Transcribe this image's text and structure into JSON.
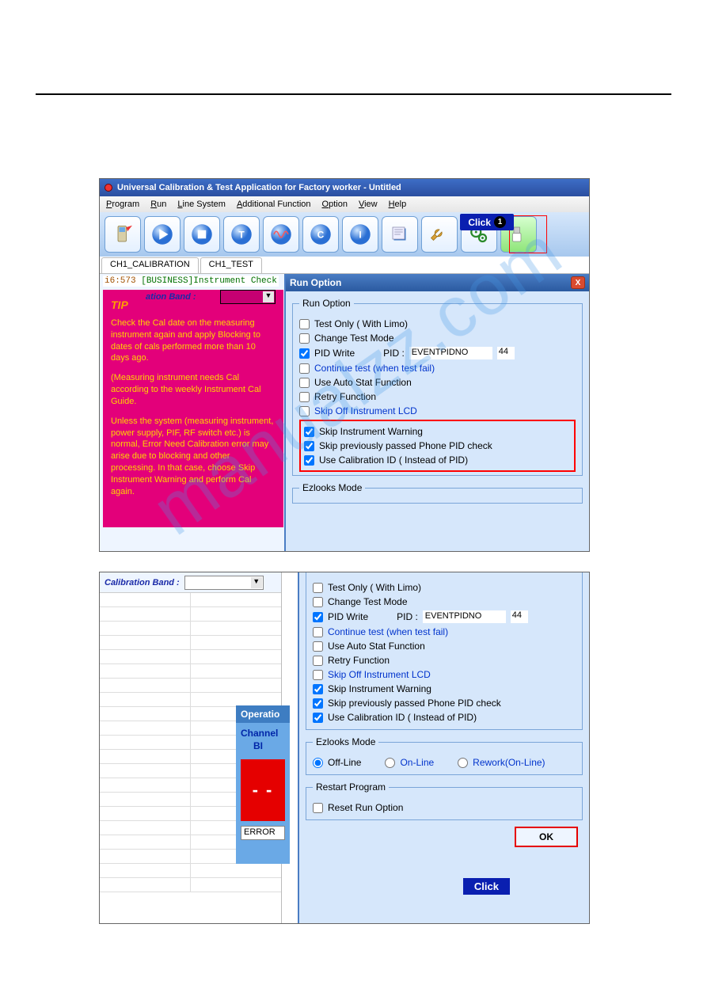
{
  "watermark": "manualzz.com",
  "app": {
    "title": "Universal Calibration & Test Application for Factory worker - Untitled",
    "menu": [
      "Program",
      "Run",
      "Line System",
      "Additional Function",
      "Option",
      "View",
      "Help"
    ],
    "tabs": [
      "CH1_CALIBRATION",
      "CH1_TEST"
    ],
    "status_line": {
      "ts": "i6:573",
      "tag": "[BUSINESS]",
      "msg": "Instrument Check"
    },
    "click_badge": "Click",
    "click_num": "1"
  },
  "tip": {
    "title": "TIP",
    "cal_band_label": "ation Band :",
    "p1": "Check the Cal date on the measuring instrument again and apply Blocking to dates of cals performed more than 10 days ago.",
    "p2": "(Measuring instrument needs Cal according to the weekly Instrument Cal Guide.",
    "p3": "Unless the system (measuring instrument, power supply, PIF, RF switch etc.) is normal, Error Need Calibration error may arise due to blocking and other processing. In that case, choose Skip Instrument Warning and perform Cal again."
  },
  "run_option": {
    "dialog_title": "Run Option",
    "group_label": "Run Option",
    "opts": {
      "test_only": "Test Only ( With Limo)",
      "change_mode": "Change Test Mode",
      "pid_write": "PID Write",
      "pid_label": "PID : ",
      "pid_value": "EVENTPIDNO",
      "pid_num": "44",
      "continue": "Continue test (when test fail)",
      "auto_stat": "Use Auto Stat Function",
      "retry": "Retry Function",
      "skip_off_lcd": "Skip Off Instrument LCD",
      "skip_warn": "Skip Instrument Warning",
      "skip_passed": "Skip previously passed Phone PID check",
      "use_cal_id": "Use Calibration ID ( Instead of PID)"
    },
    "ezlooks_label": "Ezlooks Mode",
    "ezlooks": {
      "offline": "Off-Line",
      "online": "On-Line",
      "rework": "Rework(On-Line)"
    },
    "restart_label": "Restart Program",
    "reset": "Reset Run Option",
    "ok": "OK",
    "click2": "Click"
  },
  "sc2": {
    "cal_band": "Calibration Band :",
    "operation": "Operatio",
    "channel": "Channel",
    "bi": "BI",
    "dashes": "- -",
    "error": "ERROR"
  }
}
